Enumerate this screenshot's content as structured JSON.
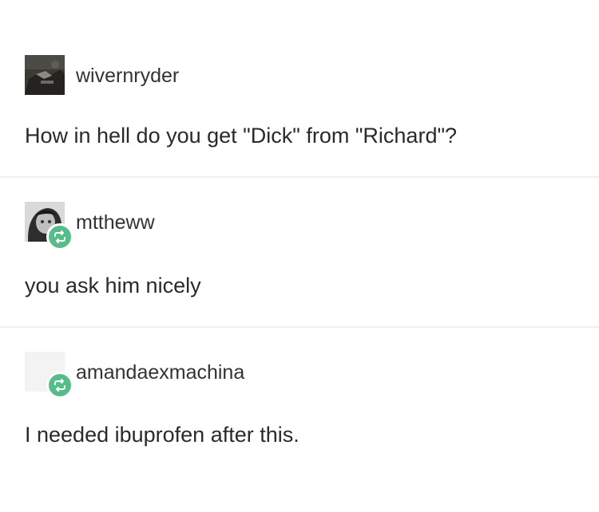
{
  "posts": [
    {
      "username": "wivernryder",
      "text": "How in hell do you get \"Dick\" from \"Richard\"?",
      "reblog": false
    },
    {
      "username": "mttheww",
      "text": "you ask him nicely",
      "reblog": true
    },
    {
      "username": "amandaexmachina",
      "text": "I needed ibuprofen after this.",
      "reblog": true
    }
  ],
  "icons": {
    "reblog": "reblog-icon",
    "avatar": "avatar"
  },
  "colors": {
    "reblog_badge": "#56bc8a",
    "divider": "#f0f0f0",
    "text": "#2a2a2a"
  }
}
